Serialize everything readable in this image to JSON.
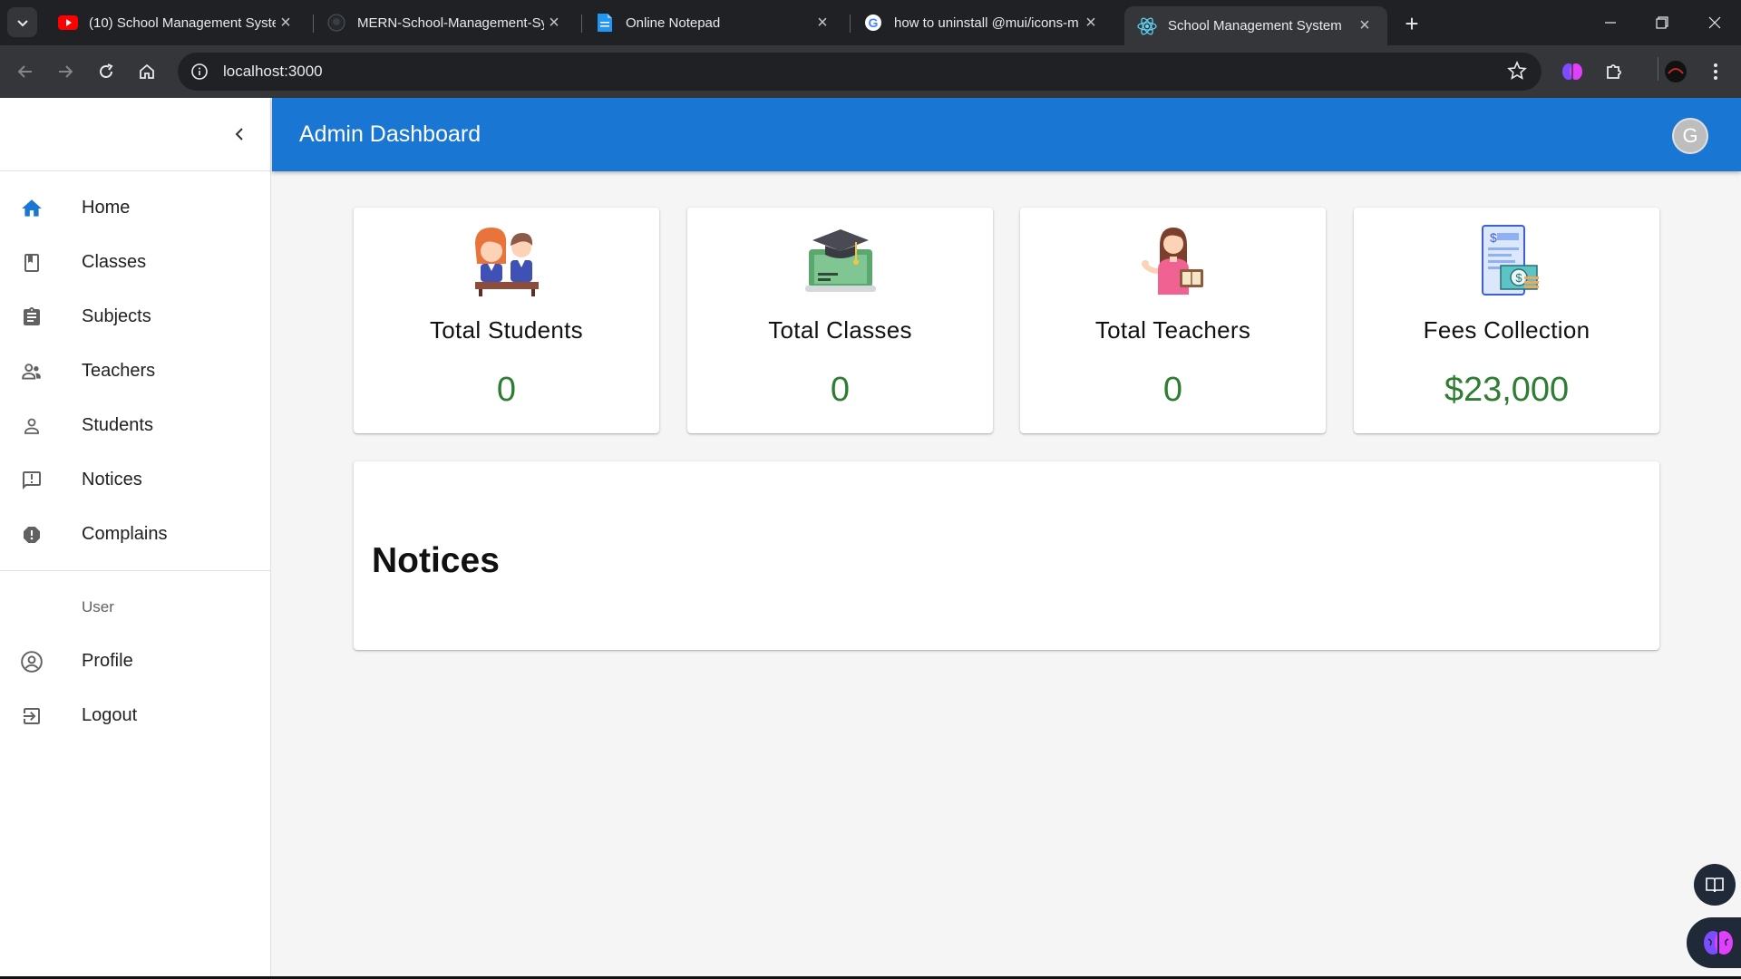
{
  "browser": {
    "tabs": [
      {
        "title": "(10) School Management Syste",
        "icon": "youtube-icon",
        "active": false
      },
      {
        "title": "MERN-School-Management-Sy",
        "icon": "github-icon",
        "active": false
      },
      {
        "title": "Online Notepad",
        "icon": "notepad-icon",
        "active": false
      },
      {
        "title": "how to uninstall @mui/icons-m",
        "icon": "google-icon",
        "active": false
      },
      {
        "title": "School Management System",
        "icon": "react-icon",
        "active": true
      }
    ],
    "url": "localhost:3000",
    "colors": {
      "frame": "#202124",
      "toolbar": "#35363a"
    }
  },
  "app": {
    "title": "Admin Dashboard",
    "avatar_letter": "G",
    "colors": {
      "appbar": "#1976d2",
      "value": "#2e7d32",
      "nav_active": "#1976d2"
    }
  },
  "sidebar": {
    "items": [
      {
        "label": "Home",
        "icon": "home-icon",
        "active": true
      },
      {
        "label": "Classes",
        "icon": "class-icon"
      },
      {
        "label": "Subjects",
        "icon": "assignment-icon"
      },
      {
        "label": "Teachers",
        "icon": "supervisor-icon"
      },
      {
        "label": "Students",
        "icon": "person-icon"
      },
      {
        "label": "Notices",
        "icon": "announcement-icon"
      },
      {
        "label": "Complains",
        "icon": "report-icon"
      }
    ],
    "subheader": "User",
    "user_items": [
      {
        "label": "Profile",
        "icon": "account-circle-icon"
      },
      {
        "label": "Logout",
        "icon": "logout-icon"
      }
    ]
  },
  "stats": [
    {
      "title": "Total Students",
      "value": "0",
      "icon": "students-illustration"
    },
    {
      "title": "Total Classes",
      "value": "0",
      "icon": "classes-illustration"
    },
    {
      "title": "Total Teachers",
      "value": "0",
      "icon": "teacher-illustration"
    },
    {
      "title": "Fees Collection",
      "value": "$23,000",
      "icon": "fees-illustration"
    }
  ],
  "notices": {
    "heading": "Notices"
  }
}
